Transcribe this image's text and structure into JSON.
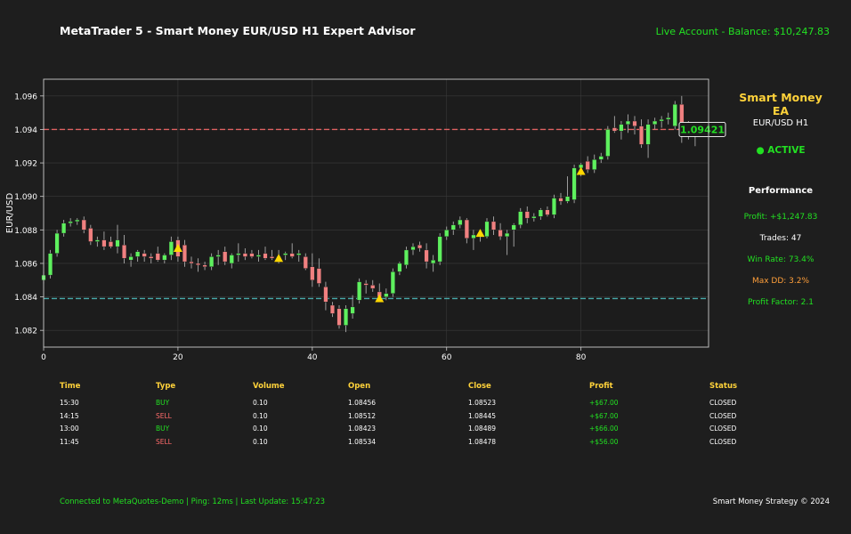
{
  "header": {
    "title": "MetaTrader 5 - Smart Money EUR/USD H1 Expert Advisor",
    "account": "Live Account - Balance: $10,247.83"
  },
  "panel": {
    "title": "Smart Money EA",
    "pair": "EUR/USD H1",
    "status": "● ACTIVE",
    "performance_heading": "Performance",
    "stats": [
      {
        "text": "Profit: +$1,247.83",
        "color": "#22e022"
      },
      {
        "text": "Trades: 47",
        "color": "#ffffff"
      },
      {
        "text": "Win Rate: 73.4%",
        "color": "#22e022"
      },
      {
        "text": "Max DD: 3.2%",
        "color": "#ff9f3a"
      },
      {
        "text": "Profit Factor: 2.1",
        "color": "#22e022"
      }
    ]
  },
  "trades": {
    "headers": [
      "Time",
      "Type",
      "Volume",
      "Open",
      "Close",
      "Profit",
      "Status"
    ],
    "rows": [
      [
        "15:30",
        "BUY",
        "0.10",
        "1.08456",
        "1.08523",
        "+$67.00",
        "CLOSED"
      ],
      [
        "14:15",
        "SELL",
        "0.10",
        "1.08512",
        "1.08445",
        "+$67.00",
        "CLOSED"
      ],
      [
        "13:00",
        "BUY",
        "0.10",
        "1.08423",
        "1.08489",
        "+$66.00",
        "CLOSED"
      ],
      [
        "11:45",
        "SELL",
        "0.10",
        "1.08534",
        "1.08478",
        "+$56.00",
        "CLOSED"
      ]
    ],
    "type_colors": {
      "BUY": "#22e022",
      "SELL": "#ff6b6b"
    },
    "profit_color": "#22e022"
  },
  "footer": {
    "connection": "Connected to MetaQuotes-Demo | Ping: 12ms | Last Update: 15:47:23",
    "copyright": "Smart Money Strategy © 2024"
  },
  "chart_data": {
    "type": "candlestick",
    "ylabel": "EUR/USD",
    "xlim": [
      0,
      99
    ],
    "ylim": [
      1.081,
      1.097
    ],
    "xticks": [
      0,
      20,
      40,
      60,
      80
    ],
    "yticks": [
      "1.082",
      "1.084",
      "1.086",
      "1.088",
      "1.090",
      "1.092",
      "1.094",
      "1.096"
    ],
    "grid": true,
    "resistance": 1.094,
    "support": 1.0839,
    "current_price": "1.09421",
    "colors": {
      "up": "#5ef05e",
      "down": "#f08080",
      "resistance": "#ff6b6b",
      "support": "#4fc3c3",
      "signal": "#ffd700"
    },
    "signals": [
      {
        "x": 20,
        "y": 1.0869
      },
      {
        "x": 35,
        "y": 1.0863
      },
      {
        "x": 50,
        "y": 1.0839
      },
      {
        "x": 65,
        "y": 1.0878
      },
      {
        "x": 80,
        "y": 1.0915
      }
    ],
    "candles": [
      {
        "x": 0,
        "o": 1.085,
        "h": 1.0855,
        "l": 1.0848,
        "c": 1.0853
      },
      {
        "x": 1,
        "o": 1.0853,
        "h": 1.0868,
        "l": 1.0851,
        "c": 1.0866
      },
      {
        "x": 2,
        "o": 1.0866,
        "h": 1.088,
        "l": 1.0864,
        "c": 1.0878
      },
      {
        "x": 3,
        "o": 1.0878,
        "h": 1.0886,
        "l": 1.0876,
        "c": 1.0884
      },
      {
        "x": 4,
        "o": 1.0884,
        "h": 1.0887,
        "l": 1.0882,
        "c": 1.0885
      },
      {
        "x": 5,
        "o": 1.0885,
        "h": 1.0887,
        "l": 1.0883,
        "c": 1.0886
      },
      {
        "x": 6,
        "o": 1.0886,
        "h": 1.0888,
        "l": 1.0878,
        "c": 1.088
      },
      {
        "x": 7,
        "o": 1.0881,
        "h": 1.0883,
        "l": 1.0871,
        "c": 1.0873
      },
      {
        "x": 8,
        "o": 1.0873,
        "h": 1.0876,
        "l": 1.087,
        "c": 1.0874
      },
      {
        "x": 9,
        "o": 1.0874,
        "h": 1.0879,
        "l": 1.0868,
        "c": 1.087
      },
      {
        "x": 10,
        "o": 1.0873,
        "h": 1.0876,
        "l": 1.0869,
        "c": 1.087
      },
      {
        "x": 11,
        "o": 1.087,
        "h": 1.0883,
        "l": 1.0866,
        "c": 1.0874
      },
      {
        "x": 12,
        "o": 1.0871,
        "h": 1.0877,
        "l": 1.086,
        "c": 1.0863
      },
      {
        "x": 13,
        "o": 1.0862,
        "h": 1.0866,
        "l": 1.0858,
        "c": 1.0864
      },
      {
        "x": 14,
        "o": 1.0864,
        "h": 1.0868,
        "l": 1.0861,
        "c": 1.0867
      },
      {
        "x": 15,
        "o": 1.0866,
        "h": 1.0868,
        "l": 1.0861,
        "c": 1.0864
      },
      {
        "x": 16,
        "o": 1.0864,
        "h": 1.0866,
        "l": 1.086,
        "c": 1.0863
      },
      {
        "x": 17,
        "o": 1.0866,
        "h": 1.087,
        "l": 1.0861,
        "c": 1.0862
      },
      {
        "x": 18,
        "o": 1.0862,
        "h": 1.0866,
        "l": 1.086,
        "c": 1.0865
      },
      {
        "x": 19,
        "o": 1.0865,
        "h": 1.0876,
        "l": 1.0862,
        "c": 1.0873
      },
      {
        "x": 20,
        "o": 1.0874,
        "h": 1.0876,
        "l": 1.0861,
        "c": 1.0864
      },
      {
        "x": 21,
        "o": 1.0871,
        "h": 1.0874,
        "l": 1.0858,
        "c": 1.0861
      },
      {
        "x": 22,
        "o": 1.0861,
        "h": 1.0864,
        "l": 1.0857,
        "c": 1.086
      },
      {
        "x": 23,
        "o": 1.086,
        "h": 1.0863,
        "l": 1.0855,
        "c": 1.0859
      },
      {
        "x": 24,
        "o": 1.0859,
        "h": 1.0861,
        "l": 1.0856,
        "c": 1.0858
      },
      {
        "x": 25,
        "o": 1.0858,
        "h": 1.0866,
        "l": 1.0856,
        "c": 1.0864
      },
      {
        "x": 26,
        "o": 1.0864,
        "h": 1.0868,
        "l": 1.0859,
        "c": 1.0865
      },
      {
        "x": 27,
        "o": 1.0867,
        "h": 1.087,
        "l": 1.0859,
        "c": 1.0861
      },
      {
        "x": 28,
        "o": 1.086,
        "h": 1.0866,
        "l": 1.0857,
        "c": 1.0865
      },
      {
        "x": 29,
        "o": 1.0865,
        "h": 1.0872,
        "l": 1.0861,
        "c": 1.0866
      },
      {
        "x": 30,
        "o": 1.0866,
        "h": 1.0869,
        "l": 1.0862,
        "c": 1.0864
      },
      {
        "x": 31,
        "o": 1.0866,
        "h": 1.0868,
        "l": 1.0863,
        "c": 1.0864
      },
      {
        "x": 32,
        "o": 1.0864,
        "h": 1.0868,
        "l": 1.0861,
        "c": 1.0865
      },
      {
        "x": 33,
        "o": 1.0866,
        "h": 1.087,
        "l": 1.0862,
        "c": 1.0863
      },
      {
        "x": 34,
        "o": 1.0864,
        "h": 1.0868,
        "l": 1.0862,
        "c": 1.0863
      },
      {
        "x": 35,
        "o": 1.0861,
        "h": 1.0868,
        "l": 1.086,
        "c": 1.0864
      },
      {
        "x": 36,
        "o": 1.0865,
        "h": 1.0867,
        "l": 1.0862,
        "c": 1.0866
      },
      {
        "x": 37,
        "o": 1.0866,
        "h": 1.0872,
        "l": 1.0863,
        "c": 1.0864
      },
      {
        "x": 38,
        "o": 1.0865,
        "h": 1.0868,
        "l": 1.0861,
        "c": 1.0866
      },
      {
        "x": 39,
        "o": 1.0864,
        "h": 1.0866,
        "l": 1.0856,
        "c": 1.0857
      },
      {
        "x": 40,
        "o": 1.0858,
        "h": 1.0866,
        "l": 1.0846,
        "c": 1.085
      },
      {
        "x": 41,
        "o": 1.0857,
        "h": 1.0863,
        "l": 1.0846,
        "c": 1.0848
      },
      {
        "x": 42,
        "o": 1.0846,
        "h": 1.0849,
        "l": 1.0832,
        "c": 1.0837
      },
      {
        "x": 43,
        "o": 1.0835,
        "h": 1.0837,
        "l": 1.0828,
        "c": 1.083
      },
      {
        "x": 44,
        "o": 1.0833,
        "h": 1.0835,
        "l": 1.0821,
        "c": 1.0823
      },
      {
        "x": 45,
        "o": 1.0823,
        "h": 1.0835,
        "l": 1.0819,
        "c": 1.0833
      },
      {
        "x": 46,
        "o": 1.083,
        "h": 1.0841,
        "l": 1.0827,
        "c": 1.0834
      },
      {
        "x": 47,
        "o": 1.0838,
        "h": 1.0851,
        "l": 1.0836,
        "c": 1.0849
      },
      {
        "x": 48,
        "o": 1.0848,
        "h": 1.085,
        "l": 1.0842,
        "c": 1.0847
      },
      {
        "x": 49,
        "o": 1.0847,
        "h": 1.085,
        "l": 1.0843,
        "c": 1.0845
      },
      {
        "x": 50,
        "o": 1.0843,
        "h": 1.0848,
        "l": 1.0839,
        "c": 1.084
      },
      {
        "x": 51,
        "o": 1.084,
        "h": 1.0845,
        "l": 1.0838,
        "c": 1.0842
      },
      {
        "x": 52,
        "o": 1.0842,
        "h": 1.0857,
        "l": 1.084,
        "c": 1.0855
      },
      {
        "x": 53,
        "o": 1.0855,
        "h": 1.0861,
        "l": 1.0853,
        "c": 1.086
      },
      {
        "x": 54,
        "o": 1.0859,
        "h": 1.087,
        "l": 1.0857,
        "c": 1.0868
      },
      {
        "x": 55,
        "o": 1.0868,
        "h": 1.0872,
        "l": 1.0865,
        "c": 1.087
      },
      {
        "x": 56,
        "o": 1.0871,
        "h": 1.0873,
        "l": 1.0867,
        "c": 1.0869
      },
      {
        "x": 57,
        "o": 1.0868,
        "h": 1.0872,
        "l": 1.0857,
        "c": 1.0861
      },
      {
        "x": 58,
        "o": 1.086,
        "h": 1.0865,
        "l": 1.0855,
        "c": 1.0862
      },
      {
        "x": 59,
        "o": 1.0861,
        "h": 1.0878,
        "l": 1.0859,
        "c": 1.0876
      },
      {
        "x": 60,
        "o": 1.0876,
        "h": 1.0882,
        "l": 1.0874,
        "c": 1.088
      },
      {
        "x": 61,
        "o": 1.088,
        "h": 1.0885,
        "l": 1.0877,
        "c": 1.0883
      },
      {
        "x": 62,
        "o": 1.0883,
        "h": 1.0888,
        "l": 1.0881,
        "c": 1.0886
      },
      {
        "x": 63,
        "o": 1.0886,
        "h": 1.0887,
        "l": 1.0872,
        "c": 1.0875
      },
      {
        "x": 64,
        "o": 1.0875,
        "h": 1.088,
        "l": 1.0868,
        "c": 1.0877
      },
      {
        "x": 65,
        "o": 1.0877,
        "h": 1.0879,
        "l": 1.0873,
        "c": 1.0876
      },
      {
        "x": 66,
        "o": 1.0876,
        "h": 1.0887,
        "l": 1.0875,
        "c": 1.0885
      },
      {
        "x": 67,
        "o": 1.0885,
        "h": 1.0888,
        "l": 1.0877,
        "c": 1.088
      },
      {
        "x": 68,
        "o": 1.088,
        "h": 1.0884,
        "l": 1.0874,
        "c": 1.0876
      },
      {
        "x": 69,
        "o": 1.0876,
        "h": 1.088,
        "l": 1.0865,
        "c": 1.0878
      },
      {
        "x": 70,
        "o": 1.088,
        "h": 1.0884,
        "l": 1.087,
        "c": 1.0883
      },
      {
        "x": 71,
        "o": 1.0883,
        "h": 1.0893,
        "l": 1.0881,
        "c": 1.0891
      },
      {
        "x": 72,
        "o": 1.0891,
        "h": 1.0894,
        "l": 1.0884,
        "c": 1.0887
      },
      {
        "x": 73,
        "o": 1.0887,
        "h": 1.089,
        "l": 1.0885,
        "c": 1.0888
      },
      {
        "x": 74,
        "o": 1.0888,
        "h": 1.0893,
        "l": 1.0886,
        "c": 1.0892
      },
      {
        "x": 75,
        "o": 1.0892,
        "h": 1.0894,
        "l": 1.0888,
        "c": 1.0889
      },
      {
        "x": 76,
        "o": 1.0889,
        "h": 1.0901,
        "l": 1.0887,
        "c": 1.0899
      },
      {
        "x": 77,
        "o": 1.0899,
        "h": 1.0902,
        "l": 1.0895,
        "c": 1.0897
      },
      {
        "x": 78,
        "o": 1.0897,
        "h": 1.0912,
        "l": 1.0896,
        "c": 1.09
      },
      {
        "x": 79,
        "o": 1.0898,
        "h": 1.0919,
        "l": 1.0896,
        "c": 1.0917
      },
      {
        "x": 80,
        "o": 1.0917,
        "h": 1.092,
        "l": 1.0912,
        "c": 1.0919
      },
      {
        "x": 81,
        "o": 1.0921,
        "h": 1.0924,
        "l": 1.0914,
        "c": 1.0916
      },
      {
        "x": 82,
        "o": 1.0916,
        "h": 1.0925,
        "l": 1.0914,
        "c": 1.0922
      },
      {
        "x": 83,
        "o": 1.0922,
        "h": 1.0926,
        "l": 1.092,
        "c": 1.0924
      },
      {
        "x": 84,
        "o": 1.0924,
        "h": 1.0942,
        "l": 1.0922,
        "c": 1.094
      },
      {
        "x": 85,
        "o": 1.0941,
        "h": 1.0948,
        "l": 1.0938,
        "c": 1.0939
      },
      {
        "x": 86,
        "o": 1.0939,
        "h": 1.0945,
        "l": 1.0934,
        "c": 1.0943
      },
      {
        "x": 87,
        "o": 1.0943,
        "h": 1.0949,
        "l": 1.0938,
        "c": 1.0945
      },
      {
        "x": 88,
        "o": 1.0945,
        "h": 1.0948,
        "l": 1.0937,
        "c": 1.0942
      },
      {
        "x": 89,
        "o": 1.0942,
        "h": 1.0946,
        "l": 1.0929,
        "c": 1.0931
      },
      {
        "x": 90,
        "o": 1.0931,
        "h": 1.0946,
        "l": 1.0923,
        "c": 1.0943
      },
      {
        "x": 91,
        "o": 1.0943,
        "h": 1.0947,
        "l": 1.094,
        "c": 1.0945
      },
      {
        "x": 92,
        "o": 1.0945,
        "h": 1.0948,
        "l": 1.0941,
        "c": 1.0946
      },
      {
        "x": 93,
        "o": 1.0946,
        "h": 1.095,
        "l": 1.0943,
        "c": 1.0947
      },
      {
        "x": 94,
        "o": 1.0942,
        "h": 1.0957,
        "l": 1.094,
        "c": 1.0955
      },
      {
        "x": 95,
        "o": 1.0955,
        "h": 1.096,
        "l": 1.0932,
        "c": 1.0942
      },
      {
        "x": 96,
        "o": 1.0944,
        "h": 1.0945,
        "l": 1.0934,
        "c": 1.0937
      },
      {
        "x": 97,
        "o": 1.0937,
        "h": 1.0942,
        "l": 1.093,
        "c": 1.094
      }
    ]
  }
}
